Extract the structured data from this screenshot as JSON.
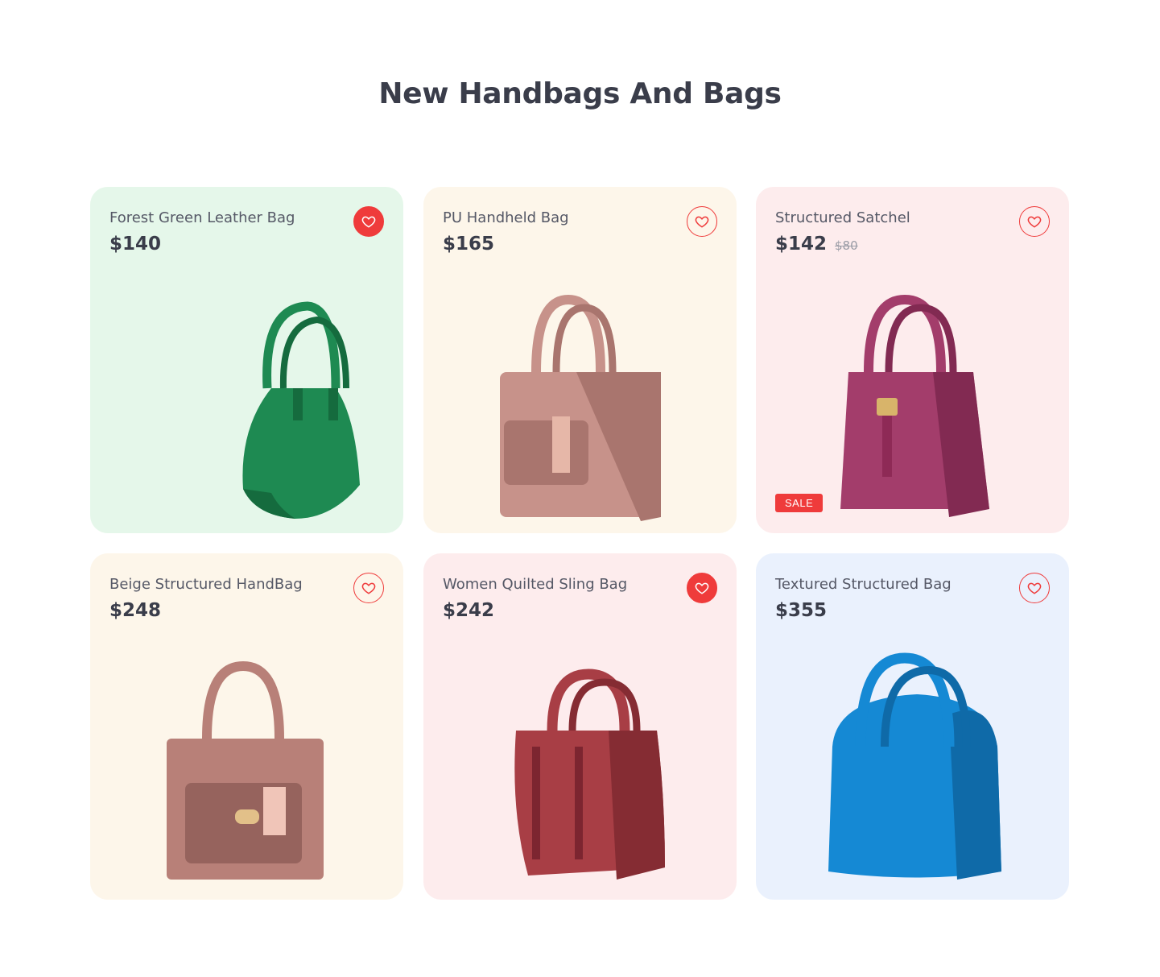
{
  "page": {
    "title": "New Handbags And Bags"
  },
  "products": [
    {
      "name": "Forest Green Leather Bag",
      "price": "$140",
      "old_price": "",
      "favorited": true,
      "sale": "",
      "bg": "#e5f7ea",
      "bag_color": "#1e8a52",
      "bag_dark": "#156b3e",
      "icon": "green-handbag-image"
    },
    {
      "name": "PU Handheld Bag",
      "price": "$165",
      "old_price": "",
      "favorited": false,
      "sale": "",
      "bg": "#fdf6ea",
      "bag_color": "#c7928a",
      "bag_dark": "#a9756e",
      "icon": "pink-tote-image"
    },
    {
      "name": "Structured Satchel",
      "price": "$142",
      "old_price": "$80",
      "favorited": false,
      "sale": "SALE",
      "bg": "#fdeced",
      "bag_color": "#a33d6b",
      "bag_dark": "#822a52",
      "icon": "magenta-satchel-image"
    },
    {
      "name": "Beige Structured HandBag",
      "price": "$248",
      "old_price": "",
      "favorited": false,
      "sale": "",
      "bg": "#fdf6ea",
      "bag_color": "#b88078",
      "bag_dark": "#96635d",
      "icon": "beige-handbag-image"
    },
    {
      "name": "Women Quilted Sling Bag",
      "price": "$242",
      "old_price": "",
      "favorited": true,
      "sale": "",
      "bg": "#fdeced",
      "bag_color": "#a83e45",
      "bag_dark": "#852c33",
      "icon": "red-sling-bag-image"
    },
    {
      "name": "Textured Structured Bag",
      "price": "$355",
      "old_price": "",
      "favorited": false,
      "sale": "",
      "bg": "#eaf1fd",
      "bag_color": "#1589d4",
      "bag_dark": "#0f6aa8",
      "icon": "blue-handbag-image"
    }
  ],
  "colors": {
    "accent": "#ef3b3b",
    "title": "#3a3d4a"
  }
}
